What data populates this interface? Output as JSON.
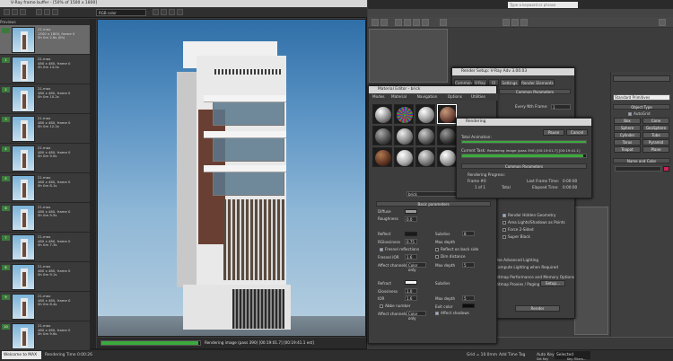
{
  "max": {
    "search_placeholder": "Type a keyword or phrase",
    "prompt": "Welcome to MAX",
    "status_left": "Rendering Time  0:00:26",
    "add_time_tag": "Add Time Tag",
    "auto_key": "Auto Key",
    "selected": "Selected",
    "set_key": "Set Key",
    "key_filters": "Key Filters...",
    "grid": "Grid = 10.0mm"
  },
  "frame_buffer": {
    "title": "V-Ray frame buffer - [50% of 1500 x 1800]",
    "channel": "RGB color",
    "history_header": "Previews",
    "history": [
      {
        "num": "",
        "text": "21.max\n1500 x 1800, frame 0\n0h 0m 2.6s (0h)",
        "selected": true
      },
      {
        "num": "1",
        "text": "21.max\n480 x 480, frame 0\n0h 0m 14.0s",
        "selected": false
      },
      {
        "num": "2",
        "text": "21.max\n480 x 480, frame 0\n0h 0m 10.2s",
        "selected": false
      },
      {
        "num": "3",
        "text": "21.max\n480 x 480, frame 0\n0h 0m 12.2s",
        "selected": false
      },
      {
        "num": "4",
        "text": "21.max\n480 x 480, frame 0\n0h 0m 9.0s",
        "selected": false
      },
      {
        "num": "5",
        "text": "21.max\n480 x 480, frame 0\n0h 0m 8.1s",
        "selected": false
      },
      {
        "num": "6",
        "text": "21.max\n480 x 480, frame 0\n0h 0m 9.5s",
        "selected": false
      },
      {
        "num": "7",
        "text": "21.max\n480 x 480, frame 0\n0h 0m 7.3s",
        "selected": false
      },
      {
        "num": "8",
        "text": "21.max\n480 x 480, frame 0\n0h 0m 9.1s",
        "selected": false
      },
      {
        "num": "9",
        "text": "21.max\n480 x 480, frame 0\n0h 0m 8.4s",
        "selected": false
      },
      {
        "num": "10",
        "text": "21.max\n480 x 480, frame 0\n0h 0m 9.6s",
        "selected": false
      }
    ],
    "status": "Rendering image (pass 390) [00:19:01.7] [00:19:41.1 est]"
  },
  "material_editor": {
    "title": "Material Editor - brick",
    "menu": [
      "Modes",
      "Material",
      "Navigation",
      "Options",
      "Utilities"
    ],
    "material_name": "brick",
    "basic_params": "Basic parameters",
    "diffuse": "Diffuse",
    "roughness": "Roughness",
    "roughness_val": "0.0",
    "reflect": "Reflect",
    "rglossiness": "RGlossiness",
    "rglossiness_val": "0.75",
    "fresnel": "Fresnel reflections",
    "fresnel_ior": "Fresnel IOR",
    "fresnel_ior_val": "1.6",
    "affect_channels": "Affect channels",
    "color_only": "Color only",
    "subdivs": "Subdivs",
    "subdivs_val": "8",
    "max_depth": "Max depth",
    "max_depth_val": "5",
    "reflect_backside": "Reflect on back side",
    "dim_distance": "Dim distance",
    "refract": "Refract",
    "glossiness": "Glossiness",
    "glossiness_val": "1.0",
    "ior": "IOR",
    "ior_val": "1.6",
    "abbe": "Abbe number",
    "exit_color": "Exit color",
    "affect_shadows": "Affect shadows"
  },
  "render_setup": {
    "title": "Render Setup: V-Ray Adv 3.00.03",
    "tabs": [
      "Common",
      "V-Ray",
      "GI",
      "Settings",
      "Render Elements"
    ],
    "common_params": "Common Parameters",
    "every_nth": "Every Nth Frame:",
    "checks": [
      "Render Hidden Geometry",
      "Area Lights/Shadows as Points",
      "Force 2-Sided",
      "Super Black"
    ],
    "advanced_lighting": "Use Advanced Lighting",
    "compute_lighting": "Compute Lighting when Required",
    "bitmap_perf": "Bitmap Performance and Memory Options",
    "bitmap_proxies": "Bitmap Proxies / Paging Disabled",
    "setup_btn": "Setup...",
    "render_btn": "Render"
  },
  "rendering": {
    "title": "Rendering",
    "pause": "Pause",
    "cancel": "Cancel",
    "total_animation": "Total Animation:",
    "current_task": "Current Task:",
    "current_task_val": "Rendering image (pass 390) [00:19:01.7] [00:19:41.1]",
    "total_progress": 1.0,
    "task_progress": 0.98,
    "common_params": "Common Parameters",
    "rendering_progress": "Rendering Progress:",
    "frame": "Frame #",
    "frame_val": "0",
    "of": "1 of 1",
    "total": "Total",
    "last_frame_time": "Last Frame Time:",
    "last_frame_val": "0:00:00",
    "elapsed_time": "Elapsed Time:",
    "elapsed_val": "0:00:00"
  },
  "command_panel": {
    "category": "Standard Primitives",
    "object_type": "Object Type",
    "autogrid": "AutoGrid",
    "buttons": [
      "Box",
      "Cone",
      "Sphere",
      "GeoSphere",
      "Cylinder",
      "Tube",
      "Torus",
      "Pyramid",
      "Teapot",
      "Plane"
    ],
    "name_color": "Name and Color"
  },
  "colors": {
    "accent_green": "#3caa3c",
    "name_swatch": "#cc2255"
  }
}
